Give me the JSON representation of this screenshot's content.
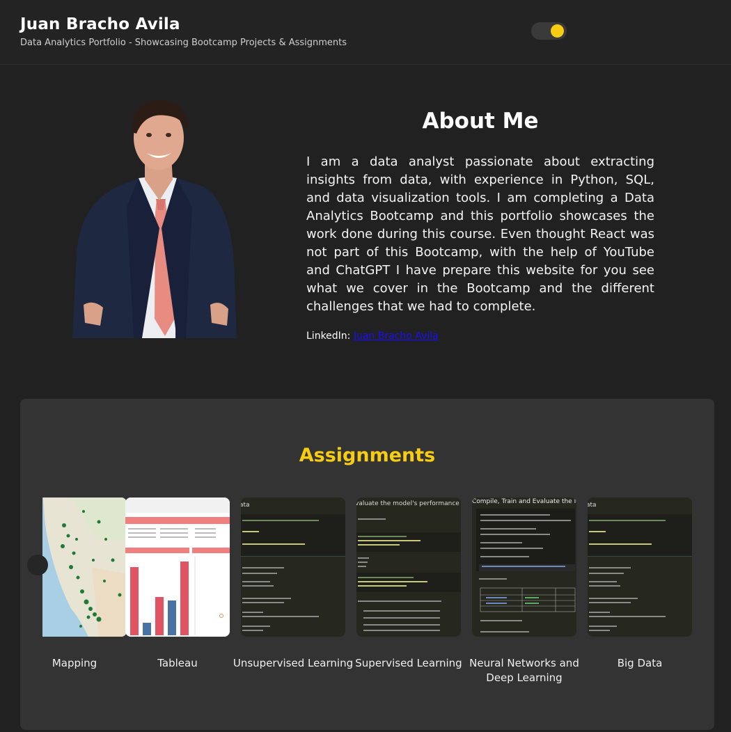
{
  "header": {
    "title": "Juan Bracho Avila",
    "subtitle": "Data Analytics Portfolio - Showcasing Bootcamp Projects & Assignments",
    "theme_toggle": "dark-mode-toggle"
  },
  "about": {
    "title": "About Me",
    "text": "I am a data analyst passionate about extracting insights from data, with experience in Python, SQL, and data visualization tools. I am completing a Data Analytics Bootcamp and this portfolio showcases the work done during this course. Even thought React was not part of this Bootcamp, with the help of YouTube and ChatGPT I have prepare this website for you see what we cover in the Bootcamp and the different challenges that we had to complete.",
    "linkedin_label": "LinkedIn:",
    "linkedin_link": "Juan Bracho Avila"
  },
  "assignments": {
    "title": "Assignments",
    "cards": [
      {
        "label": "Mapping",
        "thumb_header": ""
      },
      {
        "label": "Tableau",
        "thumb_header": ""
      },
      {
        "label": "Unsupervised Learning",
        "thumb_header": "ata"
      },
      {
        "label": "Supervised Learning",
        "thumb_header": "valuate the model's performance by doing the"
      },
      {
        "label": "Neural Networks and Deep Learning",
        "thumb_header": "Compile, Train and Evaluate the Model"
      },
      {
        "label": "Big Data",
        "thumb_header": "ata"
      }
    ]
  },
  "colors": {
    "accent": "#f8cc12",
    "background": "#212121",
    "panel": "#333333"
  }
}
